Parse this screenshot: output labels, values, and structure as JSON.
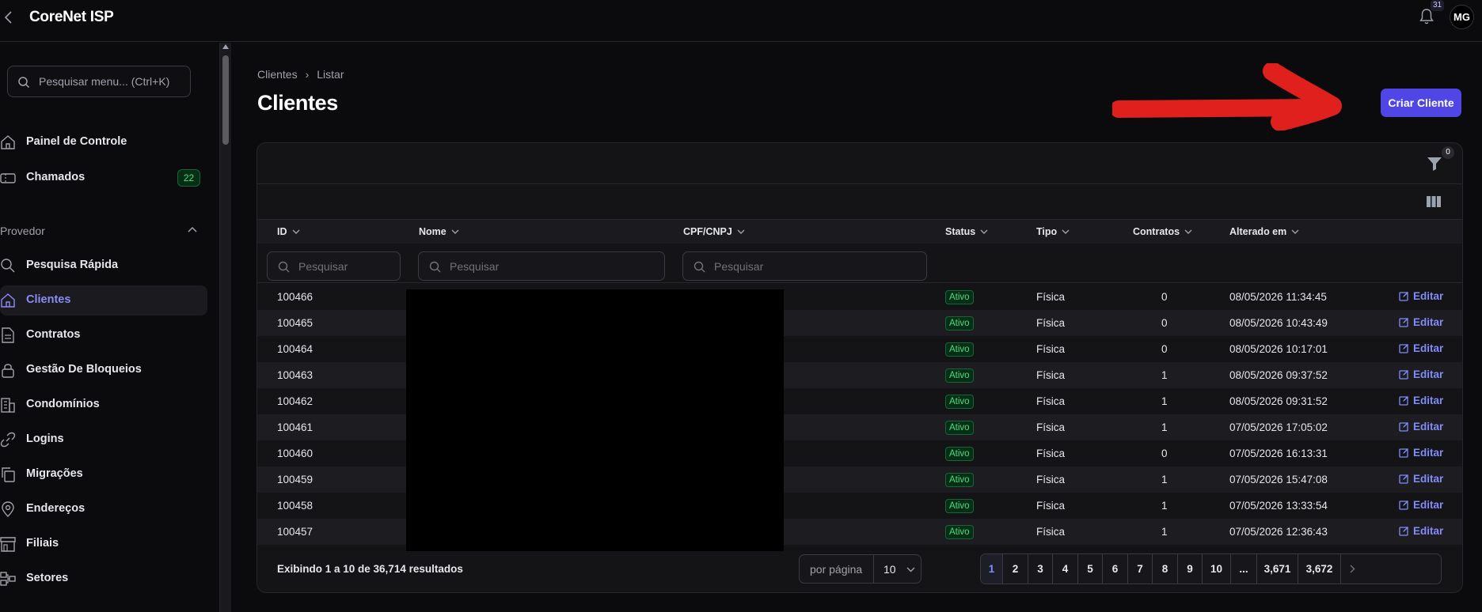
{
  "app": {
    "title": "CoreNet ISP",
    "notifications_count": "31",
    "user_initials": "MG"
  },
  "sidebar": {
    "search_placeholder": "Pesquisar menu... (Ctrl+K)",
    "items_top": [
      {
        "label": "Painel de Controle",
        "icon": "home-icon"
      },
      {
        "label": "Chamados",
        "icon": "ticket-icon",
        "badge": "22"
      }
    ],
    "group_label": "Provedor",
    "items": [
      {
        "label": "Pesquisa Rápida",
        "icon": "search-icon"
      },
      {
        "label": "Clientes",
        "icon": "home-icon",
        "active": true
      },
      {
        "label": "Contratos",
        "icon": "document-icon"
      },
      {
        "label": "Gestão De Bloqueios",
        "icon": "lock-icon"
      },
      {
        "label": "Condomínios",
        "icon": "building-icon"
      },
      {
        "label": "Logins",
        "icon": "link-icon"
      },
      {
        "label": "Migrações",
        "icon": "copy-icon"
      },
      {
        "label": "Endereços",
        "icon": "map-pin-icon"
      },
      {
        "label": "Filiais",
        "icon": "store-icon"
      },
      {
        "label": "Setores",
        "icon": "sectors-icon"
      }
    ]
  },
  "page": {
    "breadcrumb": [
      "Clientes",
      "Listar"
    ],
    "title": "Clientes",
    "create_button": "Criar Cliente"
  },
  "table": {
    "filter_count": "0",
    "columns": [
      "ID",
      "Nome",
      "CPF/CNPJ",
      "Status",
      "Tipo",
      "Contratos",
      "Alterado em"
    ],
    "search_placeholder": "Pesquisar",
    "edit_label": "Editar",
    "rows": [
      {
        "id": "100466",
        "status": "Ativo",
        "tipo": "Física",
        "contratos": "0",
        "alterado": "08/05/2026 11:34:45"
      },
      {
        "id": "100465",
        "status": "Ativo",
        "tipo": "Física",
        "contratos": "0",
        "alterado": "08/05/2026 10:43:49"
      },
      {
        "id": "100464",
        "status": "Ativo",
        "tipo": "Física",
        "contratos": "0",
        "alterado": "08/05/2026 10:17:01"
      },
      {
        "id": "100463",
        "status": "Ativo",
        "tipo": "Física",
        "contratos": "1",
        "alterado": "08/05/2026 09:37:52"
      },
      {
        "id": "100462",
        "status": "Ativo",
        "tipo": "Física",
        "contratos": "1",
        "alterado": "08/05/2026 09:31:52"
      },
      {
        "id": "100461",
        "status": "Ativo",
        "tipo": "Física",
        "contratos": "1",
        "alterado": "07/05/2026 17:05:02"
      },
      {
        "id": "100460",
        "status": "Ativo",
        "tipo": "Física",
        "contratos": "0",
        "alterado": "07/05/2026 16:13:31"
      },
      {
        "id": "100459",
        "status": "Ativo",
        "tipo": "Física",
        "contratos": "1",
        "alterado": "07/05/2026 15:47:08"
      },
      {
        "id": "100458",
        "status": "Ativo",
        "tipo": "Física",
        "contratos": "1",
        "alterado": "07/05/2026 13:33:54"
      },
      {
        "id": "100457",
        "status": "Ativo",
        "tipo": "Física",
        "contratos": "1",
        "alterado": "07/05/2026 12:36:43"
      }
    ],
    "footer_text": "Exibindo 1 a 10 de 36,714 resultados",
    "per_page_label": "por página",
    "per_page_value": "10",
    "pages": [
      "1",
      "2",
      "3",
      "4",
      "5",
      "6",
      "7",
      "8",
      "9",
      "10",
      "...",
      "3,671",
      "3,672"
    ],
    "current_page": "1"
  },
  "colors": {
    "accent": "#4f46e5",
    "active_nav": "#8b8cf8",
    "status_green": "#4ade80",
    "annotation_red": "#e0201c"
  }
}
